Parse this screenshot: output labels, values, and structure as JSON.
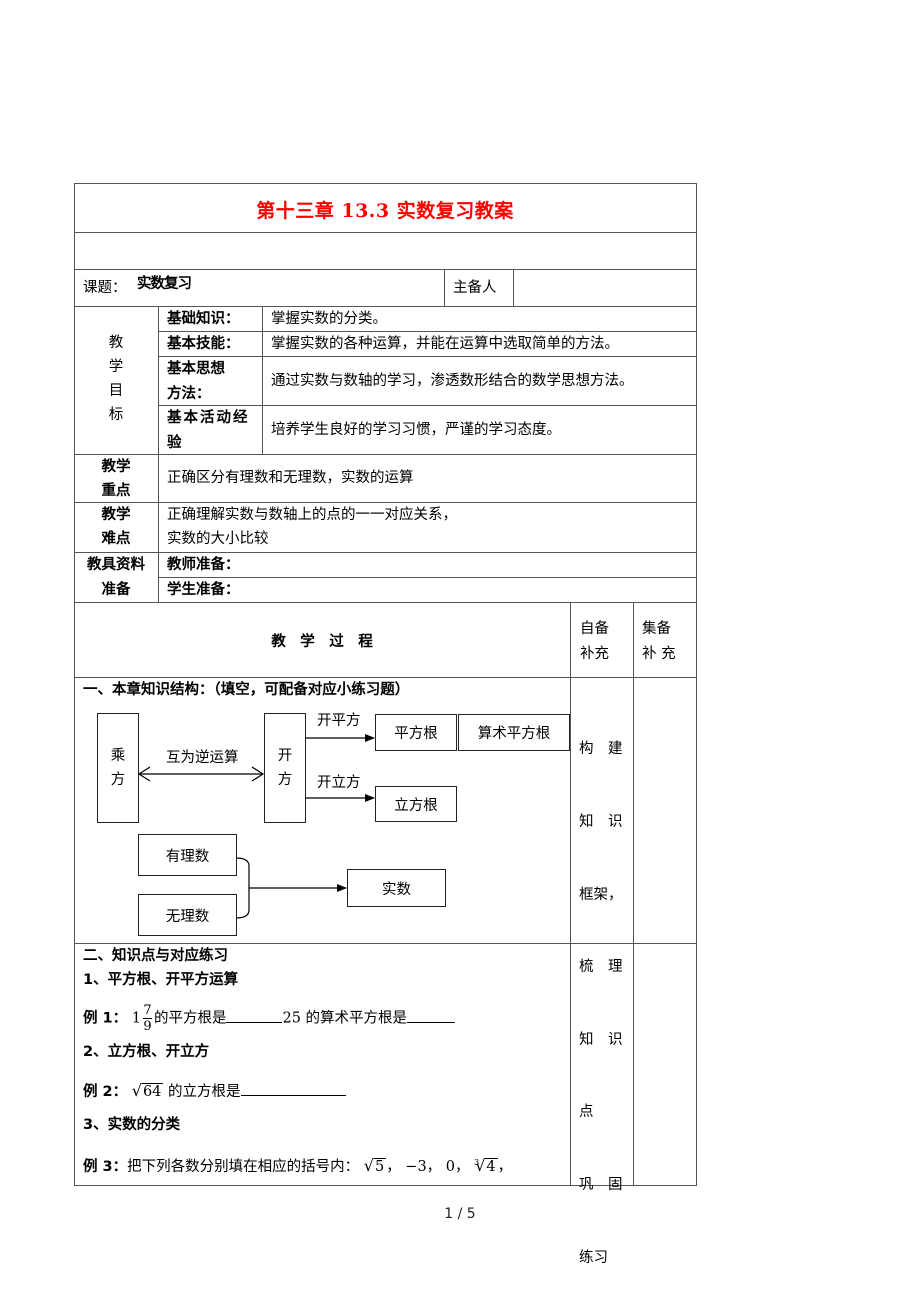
{
  "document": {
    "title": "第十三章 13.3 实数复习教案",
    "topic_label": "课题：",
    "topic_value": "实数复习",
    "preparer_label": "主备人",
    "preparer_value": "",
    "objectives": {
      "label_chars": [
        "教",
        "学",
        "目",
        "标"
      ],
      "rows": [
        {
          "label_lines": [
            "基础知识："
          ],
          "content": "掌握实数的分类。"
        },
        {
          "label_lines": [
            "基本技能："
          ],
          "content": "掌握实数的各种运算，并能在运算中选取简单的方法。"
        },
        {
          "label_lines": [
            "基本思想",
            "方法："
          ],
          "content": "通过实数与数轴的学习，渗透数形结合的数学思想方法。"
        },
        {
          "label_lines": [
            "基本活动经",
            "验"
          ],
          "content": "培养学生良好的学习习惯，严谨的学习态度。"
        }
      ]
    },
    "key_points": {
      "label_lines": [
        "教学",
        "重点"
      ],
      "content": "正确区分有理数和无理数，实数的运算"
    },
    "difficulties": {
      "label_lines": [
        "教学",
        "难点"
      ],
      "content_lines": [
        "正确理解实数与数轴上的点的一一对应关系，",
        "实数的大小比较"
      ]
    },
    "materials": {
      "label_lines": [
        "教具资料",
        "准备"
      ],
      "teacher": "教师准备：",
      "student": "学生准备："
    },
    "process": {
      "header": "教　学　过　程",
      "self_prep_lines": [
        "自备",
        "补充"
      ],
      "group_prep_lines": [
        "集备",
        "补 充"
      ],
      "section1": {
        "heading": "一、本章知识结构：（填空，可配备对应小练习题）",
        "diagram": {
          "power": [
            "乘",
            "方"
          ],
          "inverse_label": "互为逆运算",
          "root": [
            "开",
            "方"
          ],
          "sqrt_op": "开平方",
          "cbrt_op": "开立方",
          "square_root": "平方根",
          "arith_square_root": "算术平方根",
          "cube_root": "立方根",
          "rational": "有理数",
          "irrational": "无理数",
          "real": "实数"
        },
        "note_lines": [
          "构　建",
          "知　识",
          "框架，",
          "梳　理",
          "知　识",
          "点",
          "巩　固",
          "练习"
        ]
      },
      "section2": {
        "heading": "二、知识点与对应练习",
        "sub1": "1、平方根、开平方运算",
        "ex1_prefix": "例 1：",
        "ex1_whole": "1",
        "ex1_num": "7",
        "ex1_den": "9",
        "ex1_text_a": "的平方根是",
        "ex1_text_b": "25 的算术平方根是",
        "sub2": "2、立方根、开立方",
        "ex2_prefix": "例 2：",
        "ex2_radicand": "64",
        "ex2_text": "的立方根是",
        "sub3": "3、实数的分类",
        "ex3_prefix": "例 3：",
        "ex3_text": "把下列各数分别填在相应的括号内：",
        "ex3_items": [
          "5",
          "−3",
          "0",
          "4"
        ],
        "ex3_cbrt_index": "3"
      }
    },
    "page_indicator": "1 / 5"
  }
}
